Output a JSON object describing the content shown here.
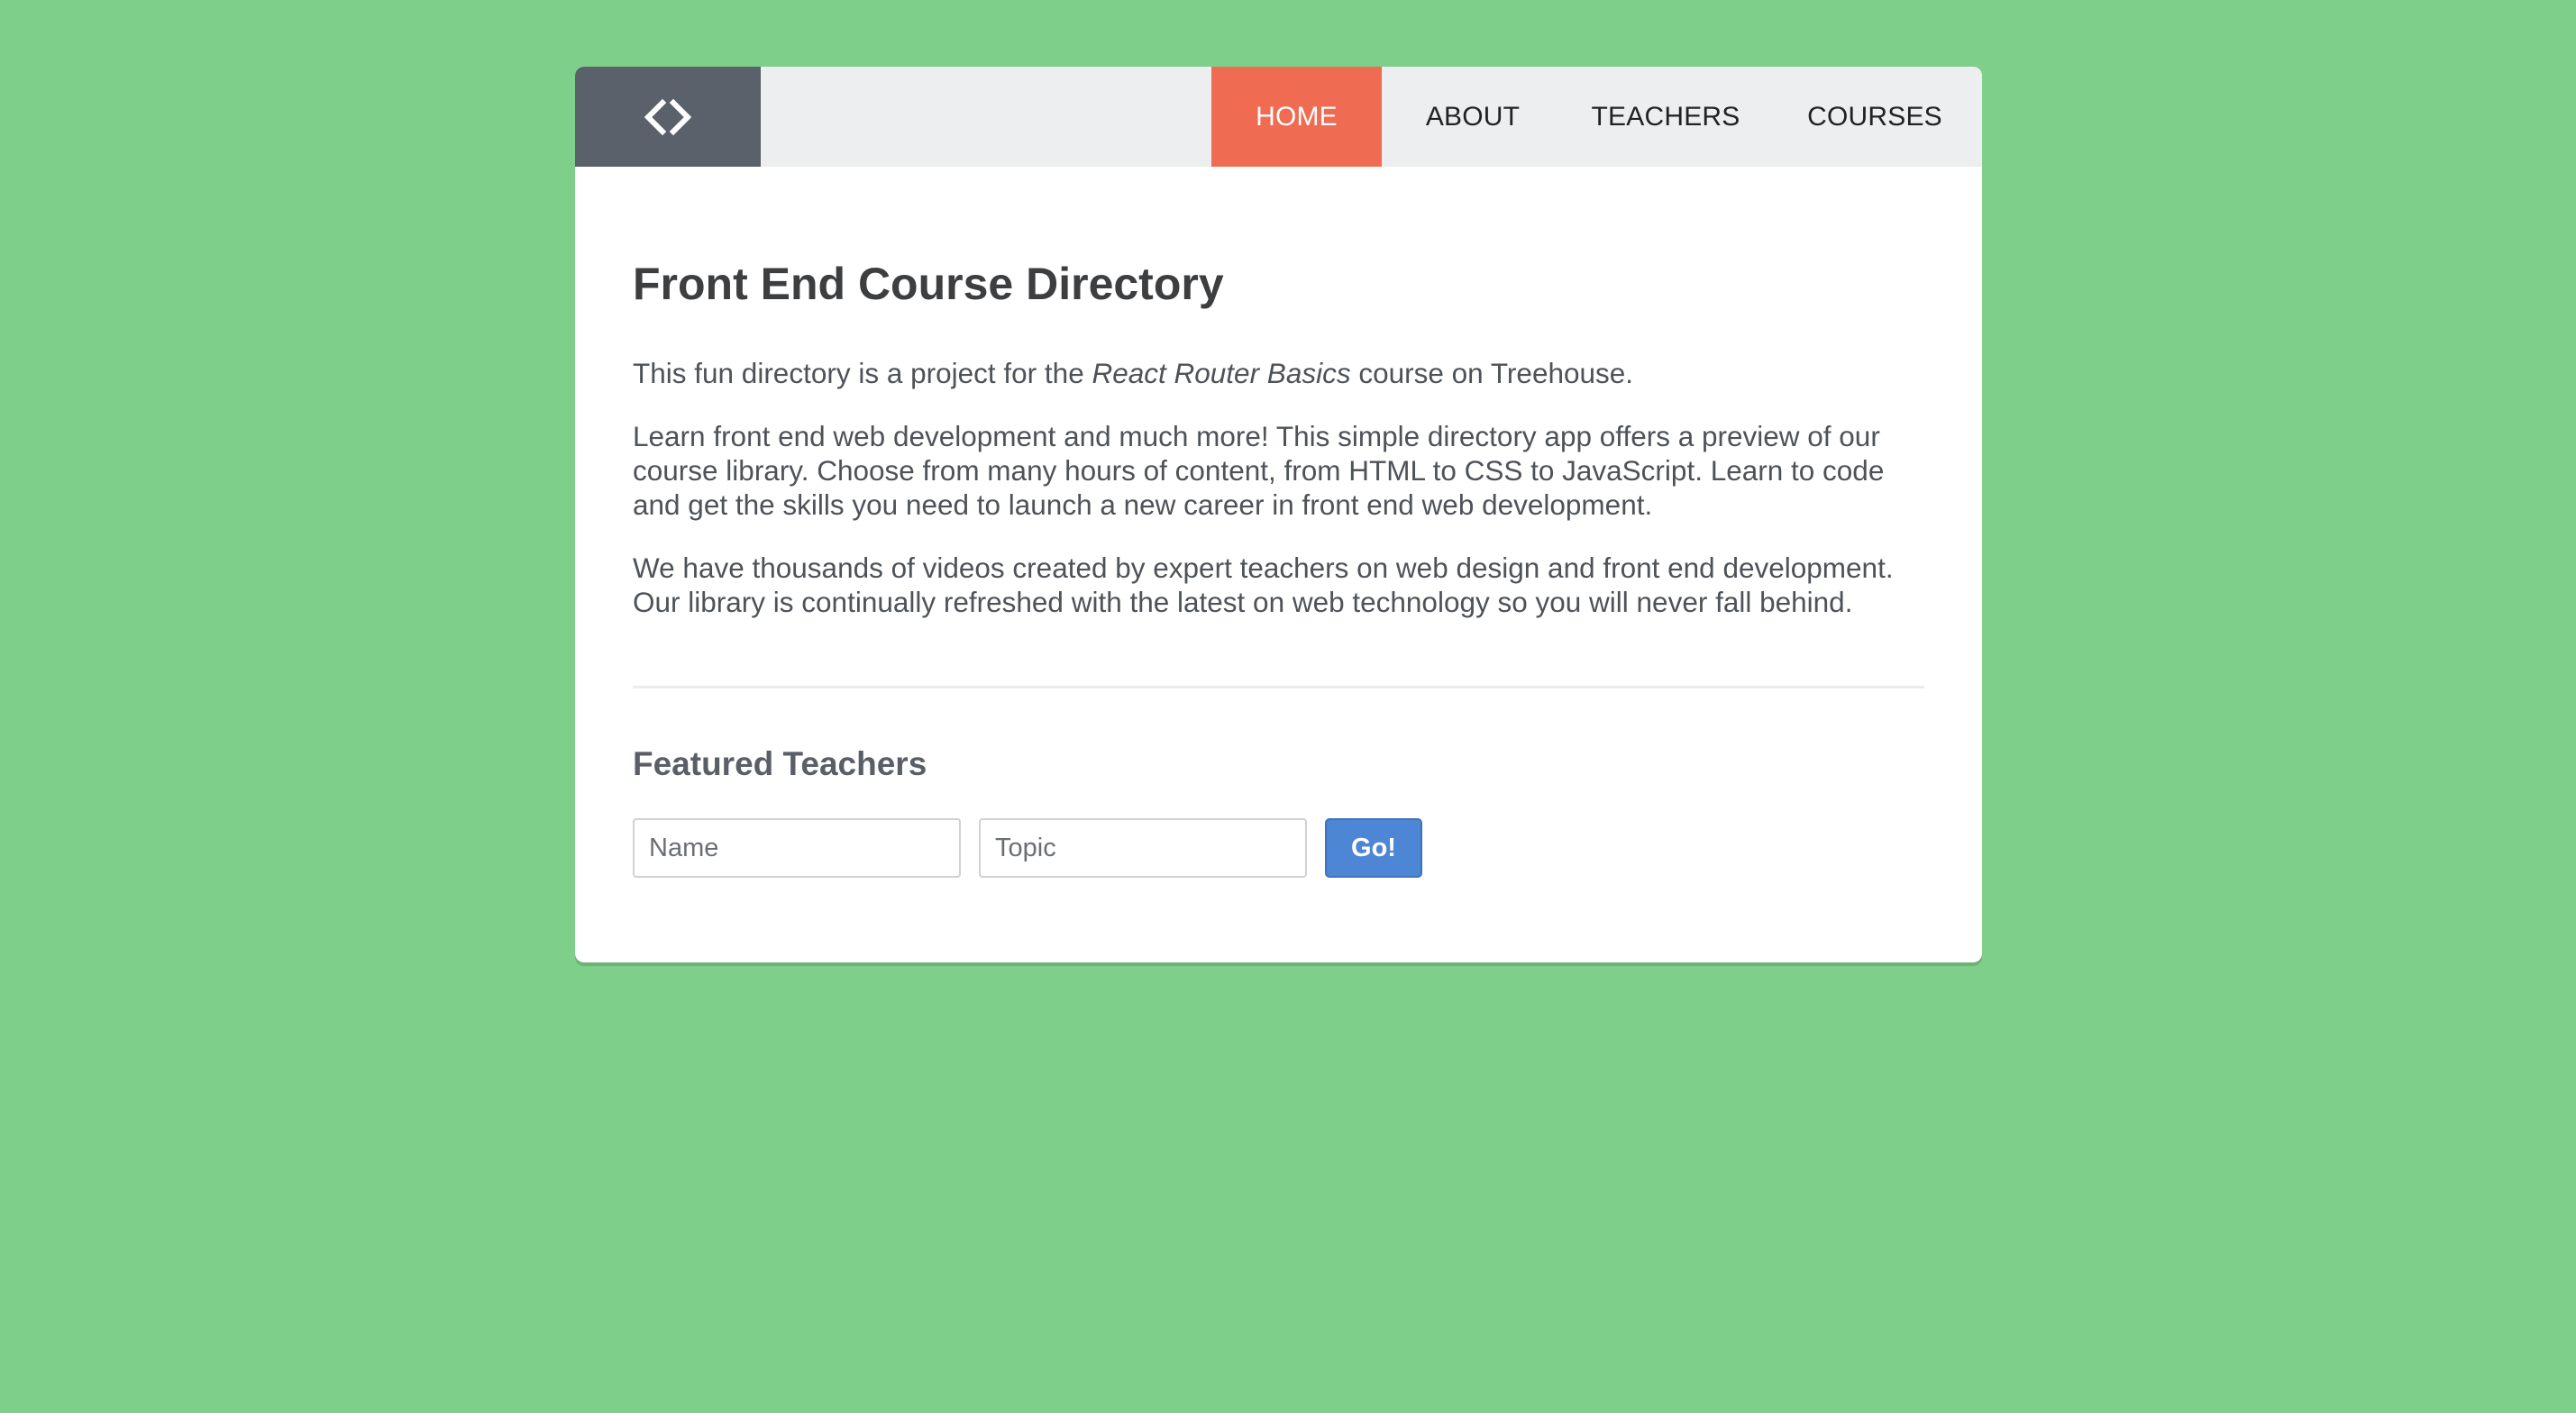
{
  "header": {
    "logo_icon": "code-brackets-icon",
    "nav": {
      "home": "HOME",
      "about": "ABOUT",
      "teachers": "TEACHERS",
      "courses": "COURSES"
    },
    "active": "home"
  },
  "main": {
    "title": "Front End Course Directory",
    "intro": {
      "before": "This fun directory is a project for the ",
      "emphasis": "React Router Basics",
      "after": " course on Treehouse."
    },
    "paragraph_1": "Learn front end web development and much more! This simple directory app offers a preview of our course library. Choose from many hours of content, from HTML to CSS to JavaScript. Learn to code and get the skills you need to launch a new career in front end web development.",
    "paragraph_2": "We have thousands of videos created by expert teachers on web design and front end development. Our library is continually refreshed with the latest on web technology so you will never fall behind.",
    "featured_heading": "Featured Teachers",
    "form": {
      "name_placeholder": "Name",
      "topic_placeholder": "Topic",
      "submit_label": "Go!"
    }
  },
  "colors": {
    "background": "#7ecf89",
    "nav_active": "#ef6b51",
    "logo_bg": "#5b616b",
    "button": "#4d86d4"
  }
}
